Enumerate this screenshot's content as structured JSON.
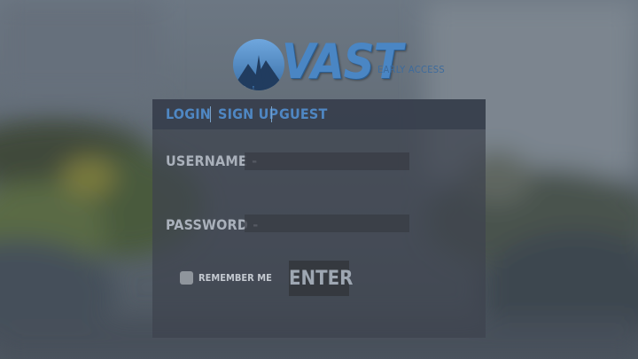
{
  "logo": {
    "wordmark": "VAST",
    "tagline": "EARLY ACCESS",
    "icon": "mountain-pine-emblem",
    "color": "#4a86c4"
  },
  "tabs": [
    {
      "label": "LOGIN"
    },
    {
      "label": "SIGN UP"
    },
    {
      "label": "GUEST"
    }
  ],
  "form": {
    "username_label": "USERNAME -",
    "username_value": "",
    "password_label": "PASSWORD -",
    "password_value": "",
    "remember_label": "REMEMBER ME",
    "remember_checked": false,
    "enter_label": "ENTER"
  },
  "colors": {
    "accent": "#4f87c3",
    "panel": "#3e444e",
    "label_text": "#aab1bb"
  }
}
